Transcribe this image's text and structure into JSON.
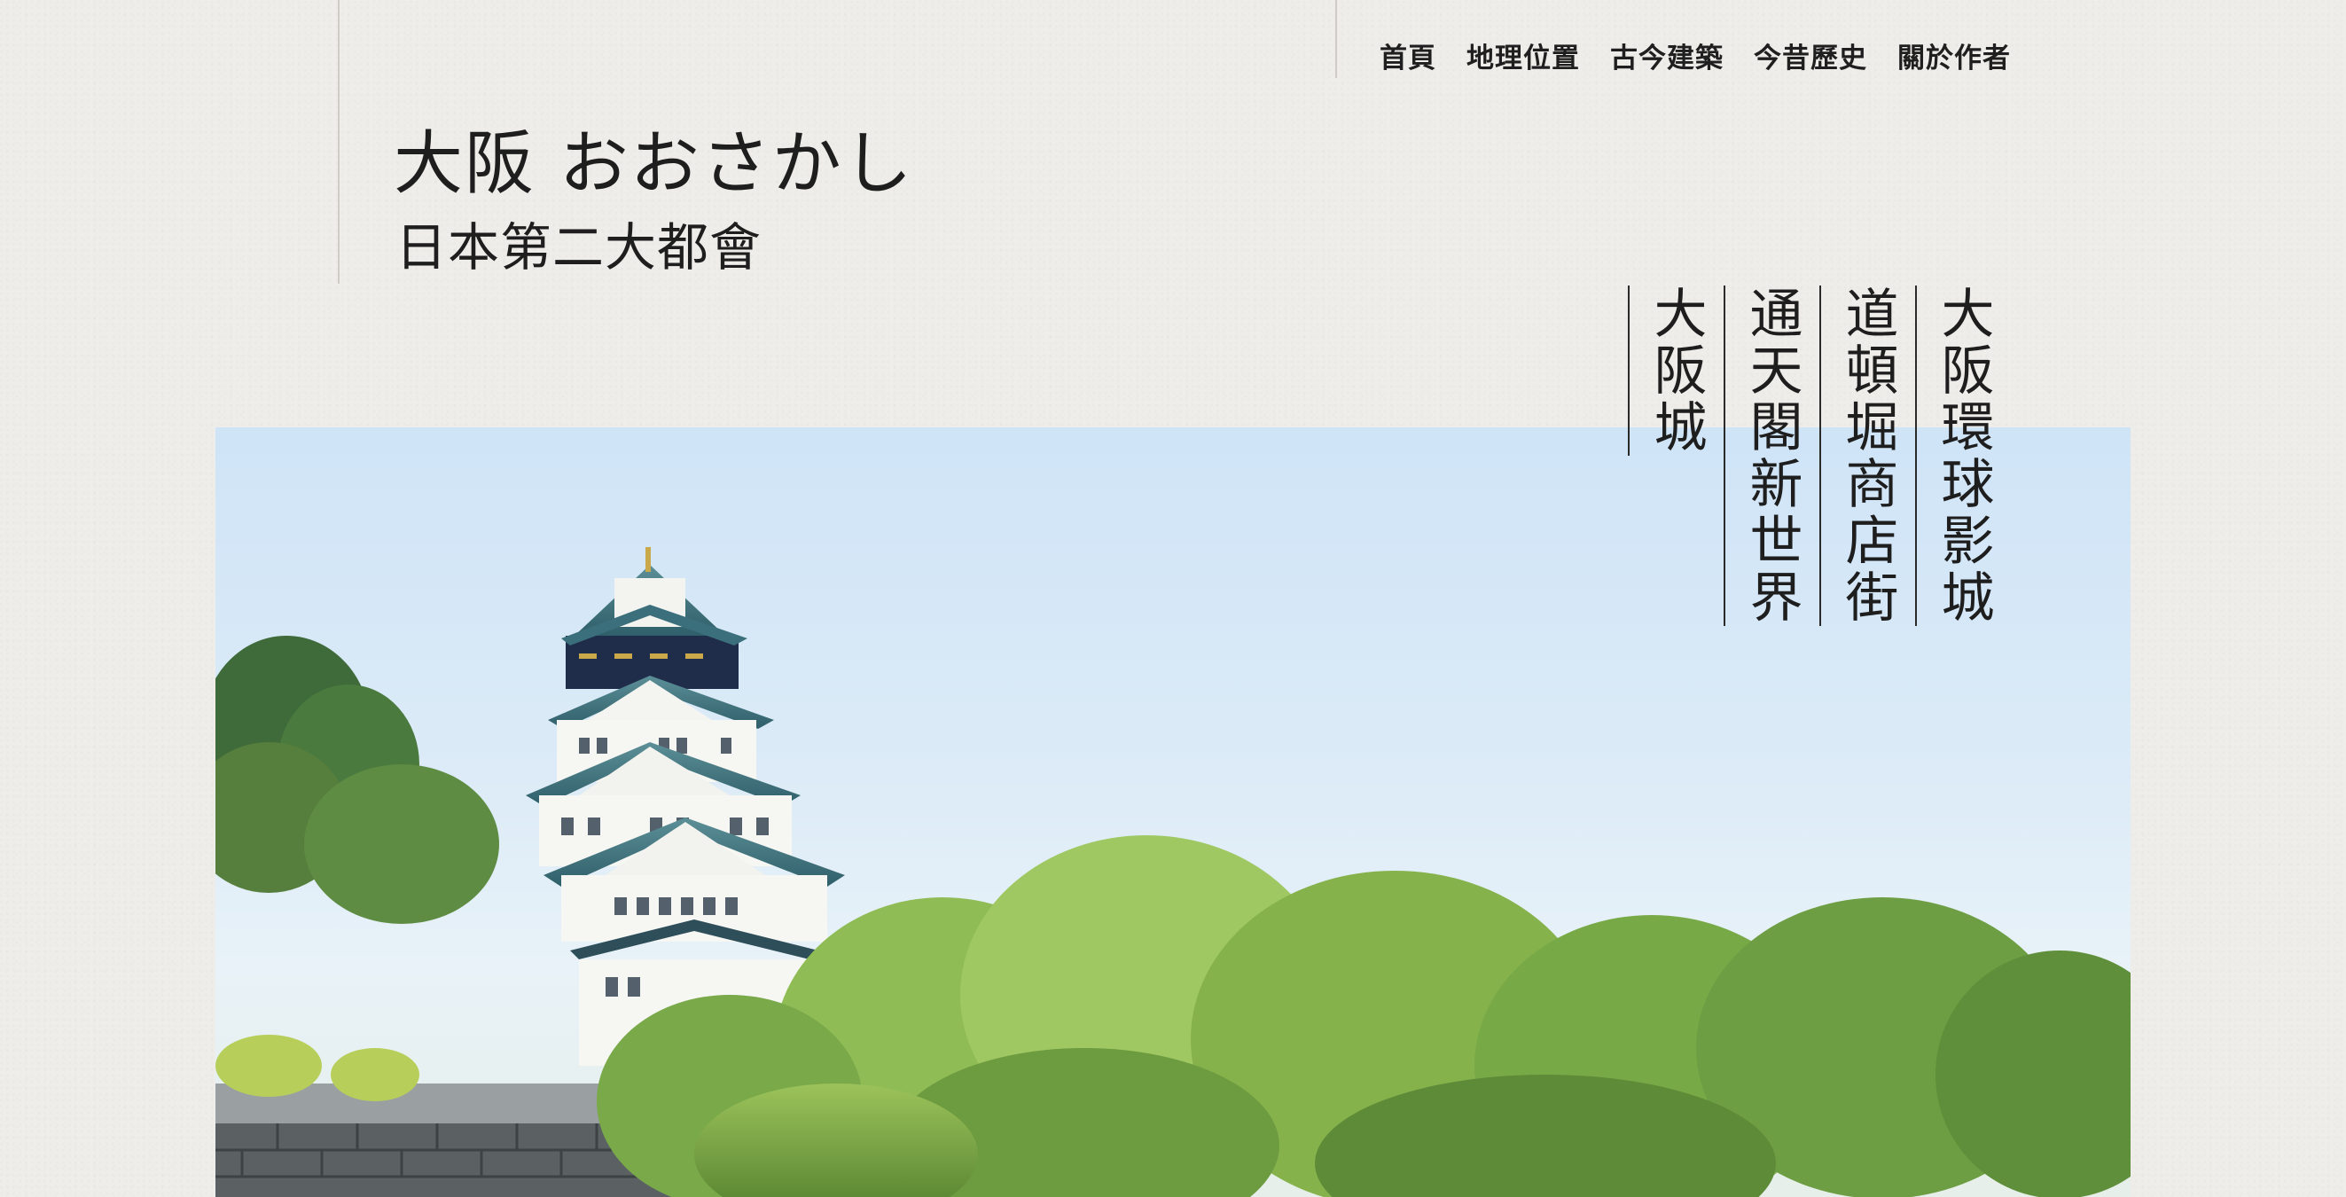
{
  "nav": {
    "items": [
      {
        "label": "首頁"
      },
      {
        "label": "地理位置"
      },
      {
        "label": "古今建築"
      },
      {
        "label": "今昔歷史"
      },
      {
        "label": "關於作者"
      }
    ]
  },
  "header": {
    "title": "大阪 おおさかし",
    "subtitle": "日本第二大都會"
  },
  "attractions": [
    {
      "label": "大阪環球影城"
    },
    {
      "label": "道頓堀商店街"
    },
    {
      "label": "通天閣新世界"
    },
    {
      "label": "大阪城"
    }
  ],
  "colors": {
    "background": "#efede9",
    "text": "#1e1e1e",
    "sky": "#cfe4f7"
  }
}
